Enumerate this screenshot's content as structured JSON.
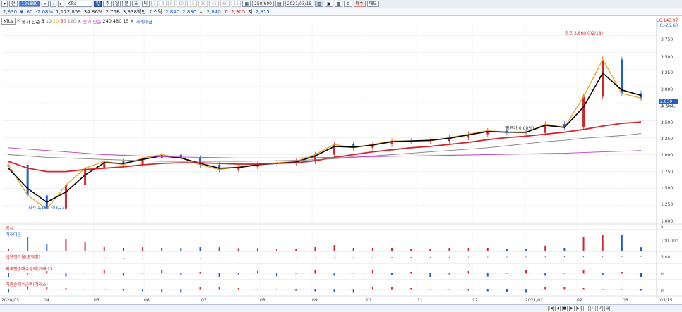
{
  "toolbar": {
    "period_label": "전",
    "stock_code": "126880",
    "stock_name": "KTcs",
    "periods": [
      "일",
      "주",
      "월",
      "분",
      "초",
      "틱"
    ],
    "minute_buttons": [
      "1",
      "3",
      "5",
      "10",
      "15",
      "30",
      "45",
      "60"
    ],
    "minute_suffix": "15",
    "count": "250/600",
    "date": "2021/03/15",
    "buttons_right": [
      "매수",
      "매도"
    ]
  },
  "quote": {
    "price": "2,830",
    "change_mark": "▼",
    "change": "60",
    "change_rate": "-2.08%",
    "volume": "1,172,859",
    "turnover": "34.86%",
    "prev_value": "2.75B",
    "amount": "3,338백만",
    "board": "코스닥",
    "start_label": "시",
    "open": "2,840",
    "high_label": "고",
    "high": "2,905",
    "low_label": "저",
    "low": "2,815",
    "first": "2,840",
    "second": "2,830"
  },
  "legend": {
    "ticker": "KTcs",
    "ma_label": "종가 단순",
    "ma_periods": [
      "5",
      "10",
      "20",
      "60",
      "120"
    ],
    "ma2_label": "종가 단순",
    "ma2_periods": [
      "240",
      "480",
      "15"
    ],
    "volume_label": "거래대금"
  },
  "price_axis": {
    "ticks": [
      "3.750",
      "3.500",
      "3.250",
      "3.000",
      "2.750",
      "2.500",
      "2.250",
      "2.000",
      "1.750",
      "1.500",
      "1.250",
      "1.000"
    ],
    "current": "2.830",
    "current_rate": "-3.95%",
    "top_labels": [
      "LC:143.97",
      "HC:-26.60"
    ]
  },
  "annotations": {
    "high": "최고 3,860 (02/18)",
    "low": "최저 1,160 (03/23)",
    "mid": "평균가(0.00%)"
  },
  "panels": {
    "p1_label": "공시",
    "p1_value": "5",
    "p2_label": "거래대금",
    "p2_value": "100,000",
    "p3_label": "신용잔고율(총액별)",
    "p3_value": "5.00",
    "p4_label": "외국인순매수금액(거래소)",
    "p4_value": "0",
    "p5_label": "기관순매수금액(거래소)",
    "p5_value": "0"
  },
  "x_axis": {
    "labels": [
      "2020/03",
      "04",
      "05",
      "06",
      "07",
      "08",
      "09",
      "10",
      "11",
      "12",
      "2021/01",
      "02",
      "03"
    ],
    "end_label": "03/15"
  },
  "colors": {
    "up": "#d2262b",
    "down": "#1f5fc7",
    "ma5": "#000000",
    "ma10": "#1f5fc7",
    "ma20": "#f0a020",
    "ma60": "#d2262b",
    "ma120": "#808080",
    "ma240": "#c040c0"
  },
  "chart_data": {
    "type": "line",
    "title": "KTcs",
    "ylim": [
      1000,
      3860
    ],
    "series": [
      {
        "name": "종가",
        "values": [
          1850,
          1400,
          1200,
          1550,
          1800,
          1900,
          1850,
          1950,
          2000,
          1950,
          1850,
          1780,
          1820,
          1860,
          1880,
          1900,
          2000,
          2150,
          2100,
          2150,
          2200,
          2200,
          2200,
          2250,
          2300,
          2350,
          2330,
          2320,
          2450,
          2400,
          2850,
          3400,
          2900,
          2830
        ]
      },
      {
        "name": "5",
        "values": [
          1800,
          1500,
          1300,
          1450,
          1700,
          1880,
          1870,
          1930,
          1980,
          1950,
          1870,
          1800,
          1810,
          1850,
          1870,
          1890,
          1980,
          2120,
          2110,
          2140,
          2190,
          2200,
          2210,
          2240,
          2290,
          2340,
          2330,
          2330,
          2430,
          2400,
          2700,
          3200,
          2950,
          2870
        ]
      },
      {
        "name": "60",
        "values": [
          1900,
          1800,
          1750,
          1750,
          1780,
          1800,
          1820,
          1850,
          1870,
          1880,
          1880,
          1870,
          1860,
          1860,
          1870,
          1880,
          1910,
          1960,
          2000,
          2040,
          2070,
          2100,
          2120,
          2150,
          2180,
          2220,
          2250,
          2270,
          2300,
          2330,
          2370,
          2420,
          2460,
          2480
        ]
      },
      {
        "name": "120",
        "values": [
          2000,
          1980,
          1960,
          1950,
          1940,
          1930,
          1920,
          1910,
          1900,
          1900,
          1900,
          1900,
          1900,
          1905,
          1910,
          1915,
          1925,
          1940,
          1960,
          1980,
          2000,
          2020,
          2040,
          2060,
          2080,
          2100,
          2130,
          2160,
          2190,
          2210,
          2240,
          2260,
          2280,
          2310
        ]
      },
      {
        "name": "240",
        "values": [
          2100,
          2080,
          2060,
          2040,
          2020,
          2000,
          1990,
          1980,
          1970,
          1965,
          1960,
          1955,
          1950,
          1950,
          1950,
          1950,
          1955,
          1960,
          1965,
          1970,
          1975,
          1980,
          1985,
          1990,
          1995,
          2000,
          2005,
          2010,
          2015,
          2020,
          2030,
          2040,
          2050,
          2060
        ]
      }
    ]
  }
}
